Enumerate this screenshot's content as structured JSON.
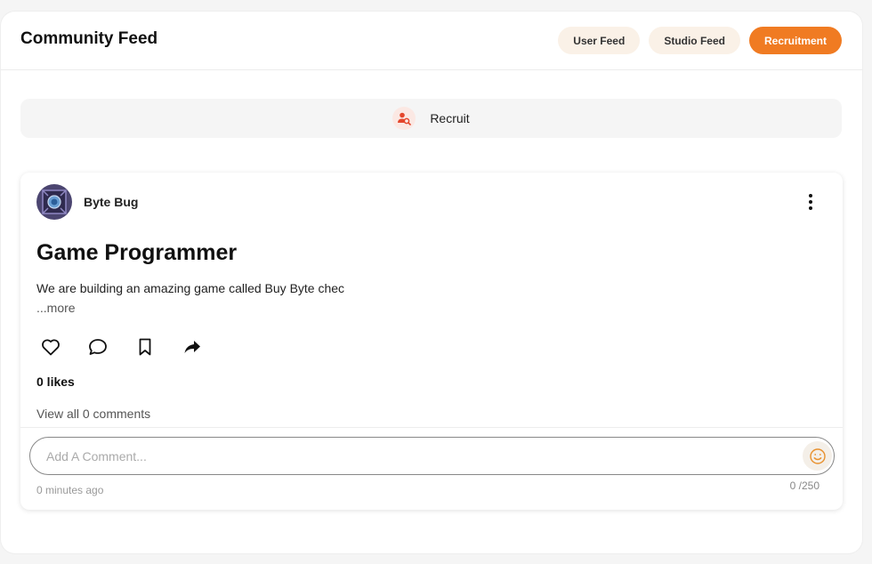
{
  "header": {
    "title": "Community Feed",
    "tabs": [
      {
        "label": "User Feed",
        "active": false
      },
      {
        "label": "Studio Feed",
        "active": false
      },
      {
        "label": "Recruitment",
        "active": true
      }
    ]
  },
  "recruit_bar": {
    "label": "Recruit",
    "icon": "user-search-icon"
  },
  "post": {
    "author": "Byte Bug",
    "title": "Game Programmer",
    "body": "We are building an amazing game called Buy Byte chec",
    "more_label": "...more",
    "likes_text": "0 likes",
    "view_comments_text": "View all 0 comments",
    "comment_placeholder": "Add A Comment...",
    "timestamp": "0 minutes ago",
    "char_count": "0 /250"
  },
  "colors": {
    "accent": "#f07b22",
    "tab_bg": "#faf1e7"
  }
}
